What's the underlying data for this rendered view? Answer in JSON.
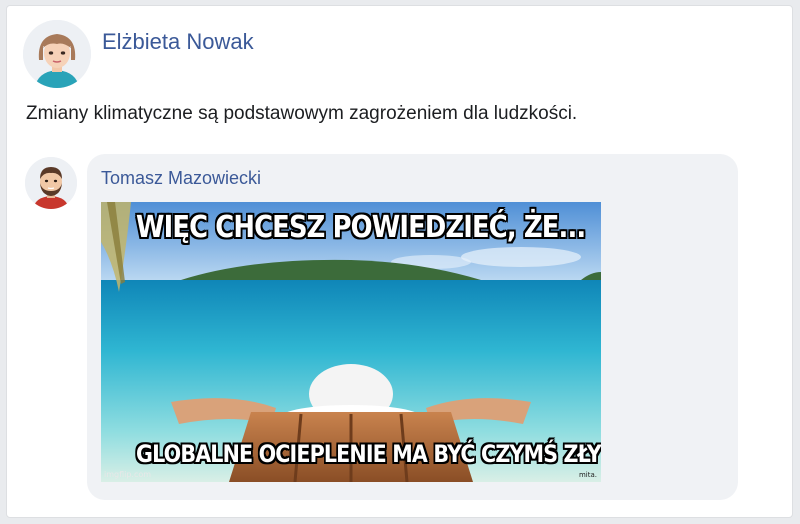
{
  "post": {
    "author": "Elżbieta Nowak",
    "text": "Zmiany klimatyczne są podstawowym zagrożeniem dla ludzkości."
  },
  "comment": {
    "author": "Tomasz Mazowiecki",
    "meme": {
      "top_text": "WIĘC CHCESZ POWIEDZIEĆ, ŻE...",
      "bottom_text": "GLOBALNE OCIEPLENIE MA BYĆ CZYMŚ ZŁYM",
      "watermark": "imgflip.com",
      "watermark_right": "mita."
    }
  },
  "colors": {
    "author_link": "#3b5998",
    "bubble": "#f0f2f5"
  }
}
